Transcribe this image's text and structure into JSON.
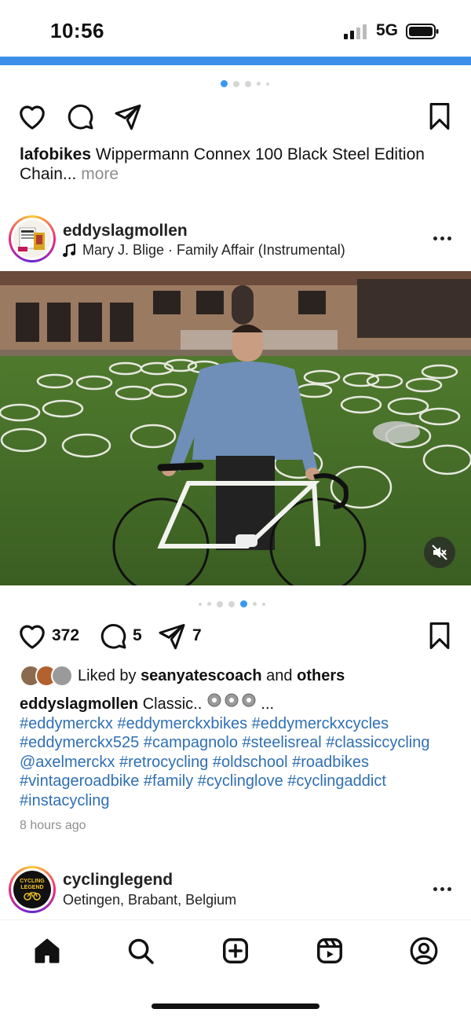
{
  "status_bar": {
    "time": "10:56",
    "network": "5G",
    "icons": [
      "signal-icon",
      "battery-icon"
    ]
  },
  "colors": {
    "accent_blue": "#3b8fe8",
    "hashtag_blue": "#2f6fb3",
    "muted_gray": "#8e8e8e",
    "indicator_active": "#3897f0"
  },
  "top_post": {
    "carousel_active_index": 0,
    "carousel_count": 5,
    "caption_user": "lafobikes",
    "caption_text": "Wippermann Connex 100 Black Steel Edition Chain...",
    "more_label": "more"
  },
  "main_post": {
    "username": "eddyslagmollen",
    "audio": "Mary J. Blige · Family Affair (Instrumental)",
    "carousel_active_index": 4,
    "carousel_count": 6,
    "likes": "372",
    "comments": "5",
    "shares": "7",
    "liked_by_prefix": "Liked by",
    "liked_by_user": "seanyatescoach",
    "liked_by_and": "and",
    "liked_by_others": "others",
    "caption_user": "eddyslagmollen",
    "caption_text": "Classic..",
    "caption_emoji_count": 3,
    "caption_suffix": "...",
    "hashtags": "#eddymerckx #eddymerckxbikes #eddymerckxcycles #eddymerckx525 #campagnolo #steelisreal #classiccycling @axelmerckx #retrocycling #oldschool #roadbikes #vintageroadbike #family #cyclinglove #cyclingaddict #instacycling",
    "time_ago": "8 hours ago"
  },
  "next_post": {
    "username": "cyclinglegend",
    "location": "Oetingen, Brabant, Belgium",
    "avatar_text_1": "CYCLING",
    "avatar_text_2": "LEGEND"
  },
  "bottom_nav": [
    "home-icon",
    "search-icon",
    "create-icon",
    "reels-icon",
    "profile-icon"
  ]
}
